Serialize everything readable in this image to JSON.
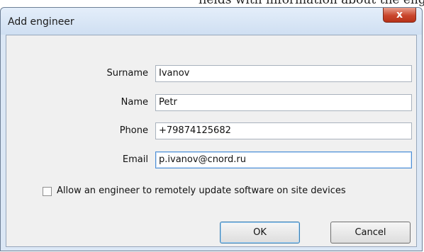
{
  "caption": "fields with information about the engineer.",
  "window": {
    "title": "Add engineer",
    "close_symbol": "x"
  },
  "fields": [
    {
      "label": "Surname",
      "value": "Ivanov"
    },
    {
      "label": "Name",
      "value": "Petr"
    },
    {
      "label": "Phone",
      "value": "+79874125682"
    },
    {
      "label": "Email",
      "value": "p.ivanov@cnord.ru"
    }
  ],
  "options": {
    "allow_remote_update_label": "Allow an engineer to remotely update software on site devices",
    "allow_remote_update_checked": false
  },
  "buttons": {
    "ok_label": "OK",
    "cancel_label": "Cancel"
  },
  "colors": {
    "frame": "#dbe7f5",
    "close_button": "#c9452c",
    "focus_border": "#4e8fd6"
  }
}
